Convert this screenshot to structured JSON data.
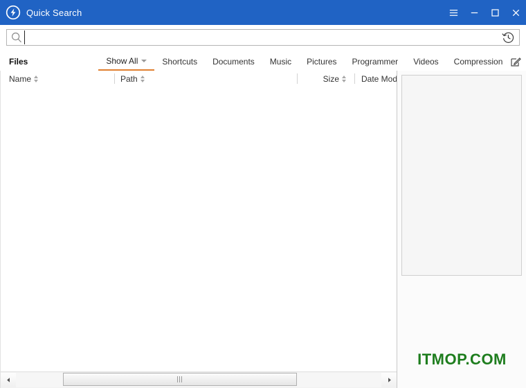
{
  "window": {
    "title": "Quick Search",
    "logo_icon": "lightning-bolt-circle-icon",
    "titlebar_color": "#2063c4",
    "controls": [
      {
        "name": "menu-button",
        "icon": "hamburger-menu-icon",
        "label": "☰"
      },
      {
        "name": "minimize-button",
        "icon": "minimize-icon",
        "label": "–"
      },
      {
        "name": "maximize-button",
        "icon": "maximize-icon",
        "label": "□"
      },
      {
        "name": "close-button",
        "icon": "close-icon",
        "label": "✕"
      }
    ]
  },
  "search": {
    "value": "",
    "placeholder": "",
    "icon": "magnifier-icon",
    "history_icon": "history-clock-icon"
  },
  "tabbar": {
    "section_label": "Files",
    "active_tab": "Show All",
    "accent_color": "#e08030",
    "tabs": [
      {
        "label": "Show All",
        "has_caret": true
      },
      {
        "label": "Shortcuts",
        "has_caret": false
      },
      {
        "label": "Documents",
        "has_caret": false
      },
      {
        "label": "Music",
        "has_caret": false
      },
      {
        "label": "Pictures",
        "has_caret": false
      },
      {
        "label": "Programmer",
        "has_caret": false
      },
      {
        "label": "Videos",
        "has_caret": false
      },
      {
        "label": "Compression",
        "has_caret": false
      }
    ],
    "edit_icon": "edit-pencil-icon",
    "collapse_icon": "chevron-up-icon"
  },
  "file_list": {
    "columns": [
      {
        "label": "Name",
        "sortable": true,
        "align": "left"
      },
      {
        "label": "Path",
        "sortable": true,
        "align": "left"
      },
      {
        "label": "Size",
        "sortable": true,
        "align": "right"
      },
      {
        "label": "Date Modi",
        "sortable": false,
        "align": "left"
      }
    ],
    "rows": []
  },
  "scrollbar": {
    "left_arrow": "◄",
    "right_arrow": "►",
    "grip": "scroll-thumb-grip"
  },
  "preview": {
    "content": ""
  },
  "watermark": {
    "text": "ITMOP.COM",
    "color": "#1e7d1e"
  }
}
